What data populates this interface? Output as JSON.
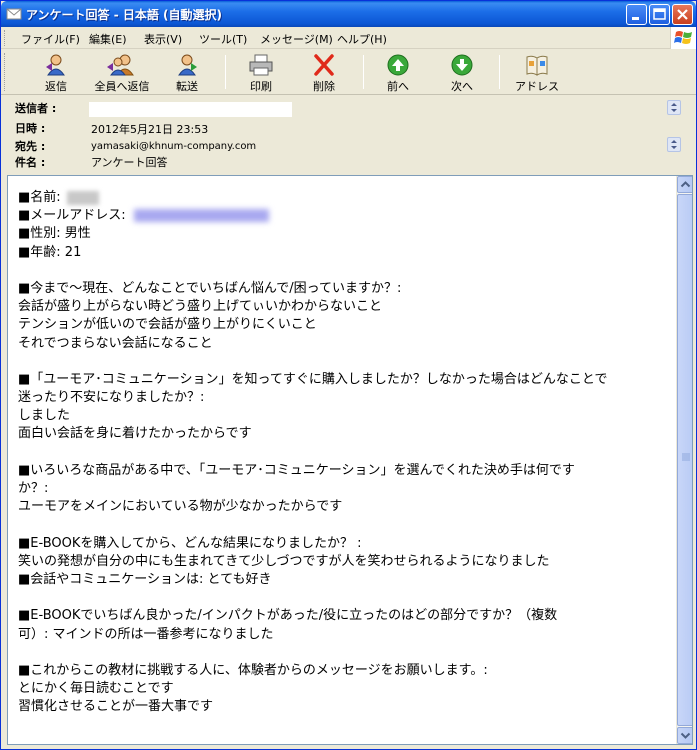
{
  "window": {
    "title": "アンケート回答 - 日本語 (自動選択)"
  },
  "menu": {
    "items": [
      "ファイル(F)",
      "編集(E)",
      "表示(V)",
      "ツール(T)",
      "メッセージ(M)",
      "ヘルプ(H)"
    ]
  },
  "toolbar": {
    "reply": "返信",
    "reply_all": "全員へ返信",
    "forward": "転送",
    "print": "印刷",
    "delete": "削除",
    "previous": "前へ",
    "next": "次へ",
    "addresses": "アドレス"
  },
  "header": {
    "from_label": "送信者 :",
    "date_label": "日時 :",
    "date_value": "2012年5月21日 23:53",
    "to_label": "宛先 :",
    "to_value": "yamasaki@khnum-company.com",
    "subject_label": "件名 :",
    "subject_value": "アンケート回答"
  },
  "body": {
    "lines": [
      "■名前:",
      "■メールアドレス:",
      "■性別: 男性",
      "■年齢: 21",
      "",
      "■今まで～現在、どんなことでいちばん悩んで/困っていますか？:",
      "会話が盛り上がらない時どう盛り上げてぃいかわからないこと",
      "テンションが低いので会話が盛り上がりにくいこと",
      "それでつまらない会話になること",
      "",
      "■「ユーモア･コミュニケーション」を知ってすぐに購入しましたか？しなかった場合はどんなことで",
      "迷ったり不安になりましたか？:",
      "しました",
      "面白い会話を身に着けたかったからです",
      "",
      "■いろいろな商品がある中で、「ユーモア･コミュニケーション」を選んでくれた決め手は何です",
      "か？:",
      "ユーモアをメインにおいている物が少なかったからです",
      "",
      "■E-BOOKを購入してから、どんな結果になりましたか？ :",
      "笑いの発想が自分の中にも生まれてきて少しづつですが人を笑わせられるようになりました",
      "■会話やコミュニケーションは: とても好き",
      "",
      "■E-BOOKでいちばん良かった/インパクトがあった/役に立ったのはどの部分ですか？（複数",
      "可）: マインドの所は一番参考になりました",
      "",
      "■これからこの教材に挑戦する人に、体験者からのメッセージをお願いします。:",
      "とにかく毎日読むことです",
      "習慣化させることが一番大事です"
    ]
  }
}
